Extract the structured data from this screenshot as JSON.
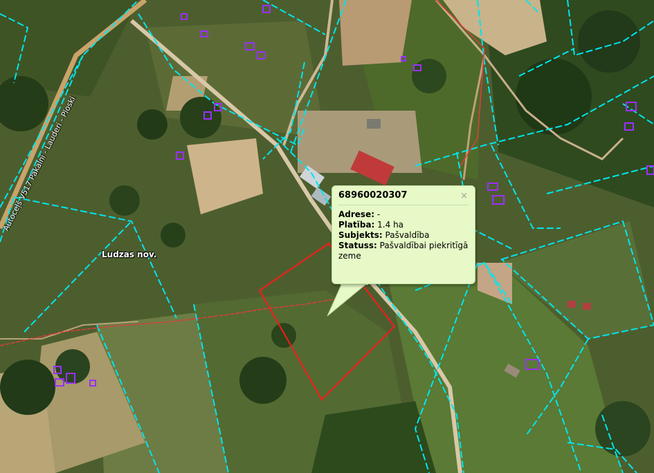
{
  "map": {
    "region_label": "Ludzas nov.",
    "road_label": "Autoceļš V517 Pakalni - Lauderi - Ploski"
  },
  "popup": {
    "title": "68960020307",
    "close_glyph": "×",
    "fields": [
      {
        "label": "Adrese:",
        "value": "-"
      },
      {
        "label": "Platība:",
        "value": "1.4 ha"
      },
      {
        "label": "Subjekts:",
        "value": "Pašvaldība"
      },
      {
        "label": "Statuss:",
        "value": "Pašvaldībai piekritīgā zeme"
      }
    ]
  },
  "colors": {
    "parcel_boundary": "#00e5ee",
    "selected_parcel": "#ff1a1a",
    "building_outline": "#9b30ff",
    "popup_background": "#e6f9c6"
  }
}
